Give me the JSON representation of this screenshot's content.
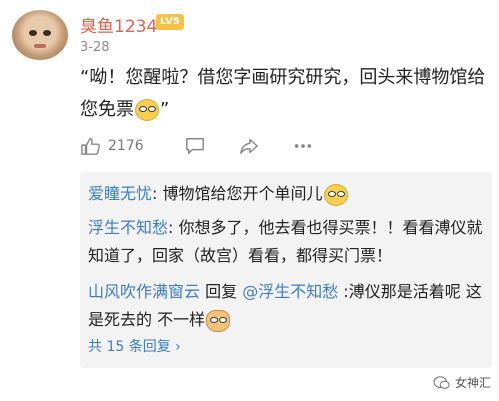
{
  "post": {
    "username": "臭鱼1234",
    "level_badge": "LV5",
    "date": "3-28",
    "text": "“呦！您醒啦？借您字画研究研究，回头来博物馆给您免票",
    "text_end": "”"
  },
  "actions": {
    "like_count": "2176",
    "icons": [
      "thumb-up-icon",
      "comment-icon",
      "share-icon",
      "more-dots-icon"
    ]
  },
  "replies": [
    {
      "user": "爱瞳无忧",
      "separator": ": ",
      "text": "博物馆给您开个单间儿",
      "emoji": "smirk-emoji"
    },
    {
      "user": "浮生不知愁",
      "separator": ": ",
      "text": "你想多了，他去看也得买票！！看看溥仪就知道了，回家（故宫）看看，都得买门票！"
    },
    {
      "user": "山风吹作满窗云",
      "middle": " 回复 ",
      "mention": "@浮生不知愁",
      "separator": " :",
      "text": "溥仪那是活着呢 这是死去的 不一样",
      "emoji": "doge-emoji"
    }
  ],
  "more_replies": "共 15 条回复 ›",
  "watermark": "女神汇",
  "colors": {
    "username": "#e2624a",
    "link": "#3d7cc9",
    "badge": "#f7c244",
    "reply_bg": "#f3f3f3"
  }
}
